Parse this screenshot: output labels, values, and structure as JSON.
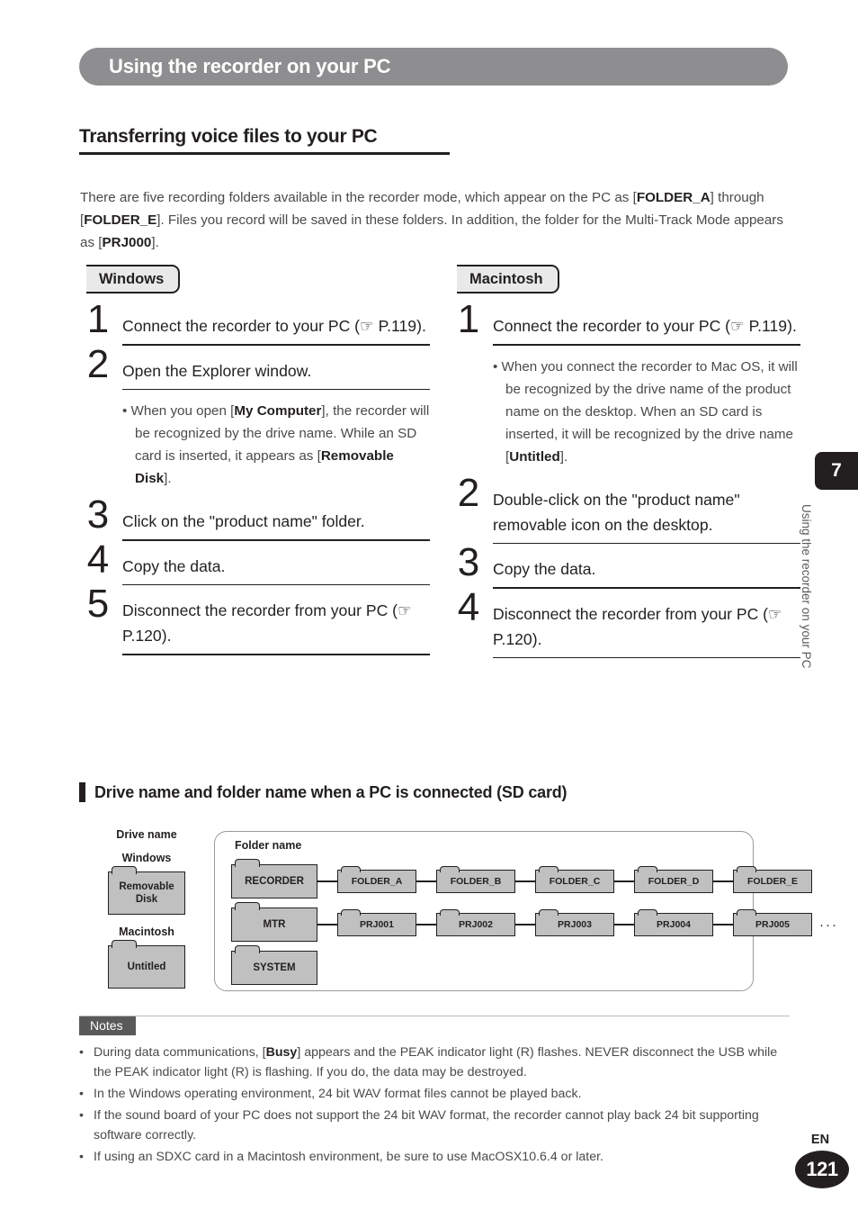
{
  "banner": {
    "title": "Using the recorder on your PC"
  },
  "section": {
    "heading": "Transferring voice files to your PC"
  },
  "intro": {
    "p1a": "There are five recording folders available in the recorder mode, which appear on the PC as [",
    "b1": "FOLDER_A",
    "p1b": "] through [",
    "b2": "FOLDER_E",
    "p1c": "]. Files you record will be saved in these folders. In addition, the folder for the Multi-Track Mode appears as [",
    "b3": "PRJ000",
    "p1d": "]."
  },
  "windows": {
    "tab_label": "Windows",
    "steps": [
      {
        "num": "1",
        "text": "Connect the recorder to your PC (☞ P.119)."
      },
      {
        "num": "2",
        "text": "Open the Explorer window."
      },
      {
        "num": "3",
        "text": "Click on the \"product name\" folder."
      },
      {
        "num": "4",
        "text": "Copy the data."
      },
      {
        "num": "5",
        "text": "Disconnect the recorder from your PC (☞ P.120)."
      }
    ],
    "note": {
      "a": "When you open [",
      "b1": "My Computer",
      "b": "], the recorder will be recognized by the drive name. While an SD card is inserted, it appears as [",
      "b2": "Removable Disk",
      "c": "]."
    }
  },
  "macintosh": {
    "tab_label": "Macintosh",
    "steps": [
      {
        "num": "1",
        "text": "Connect the recorder to your PC (☞ P.119)."
      },
      {
        "num": "2",
        "text": "Double-click on the \"product name\" removable icon on the desktop."
      },
      {
        "num": "3",
        "text": "Copy the data."
      },
      {
        "num": "4",
        "text": "Disconnect the recorder from your PC (☞ P.120)."
      }
    ],
    "note": {
      "a": "When you connect the recorder to Mac OS, it will be recognized by the drive name of the product name on the desktop. When an SD card is inserted, it will be recognized by the drive name [",
      "b1": "Untitled",
      "c": "]."
    }
  },
  "diagram": {
    "heading": "Drive name and folder name when a PC is connected (SD card)",
    "drive_label": "Drive name",
    "folder_label": "Folder name",
    "windows_label": "Windows",
    "windows_drive": "Removable Disk",
    "macintosh_label": "Macintosh",
    "macintosh_drive": "Untitled",
    "rows": [
      {
        "root": "RECORDER",
        "children": [
          "FOLDER_A",
          "FOLDER_B",
          "FOLDER_C",
          "FOLDER_D",
          "FOLDER_E"
        ],
        "ellipsis": ""
      },
      {
        "root": "MTR",
        "children": [
          "PRJ001",
          "PRJ002",
          "PRJ003",
          "PRJ004",
          "PRJ005"
        ],
        "ellipsis": "···"
      },
      {
        "root": "SYSTEM",
        "children": [],
        "ellipsis": ""
      }
    ]
  },
  "notes": {
    "badge": "Notes",
    "items": [
      {
        "a": "During data communications, [",
        "b": "Busy",
        "c": "] appears and the PEAK indicator light (R) flashes. NEVER disconnect the USB while the  PEAK indicator light (R) is flashing. If you do, the data may be destroyed."
      },
      {
        "a": "In the Windows operating environment, 24 bit WAV format files cannot be played back.",
        "b": "",
        "c": ""
      },
      {
        "a": "If the sound board of your PC does not support the 24 bit WAV format, the recorder cannot play back 24 bit supporting software correctly.",
        "b": "",
        "c": ""
      },
      {
        "a": "If using an SDXC card in a Macintosh environment, be sure to use MacOSX10.6.4 or later.",
        "b": "",
        "c": ""
      }
    ]
  },
  "side": {
    "chapter": "7",
    "label": "Using the recorder on your PC"
  },
  "footer": {
    "lang": "EN",
    "page": "121"
  },
  "colors": {
    "banner": "#8e8e90",
    "folder_fill": "#c0c0c0",
    "notes_badge": "#595959",
    "ink": "#231f20"
  }
}
